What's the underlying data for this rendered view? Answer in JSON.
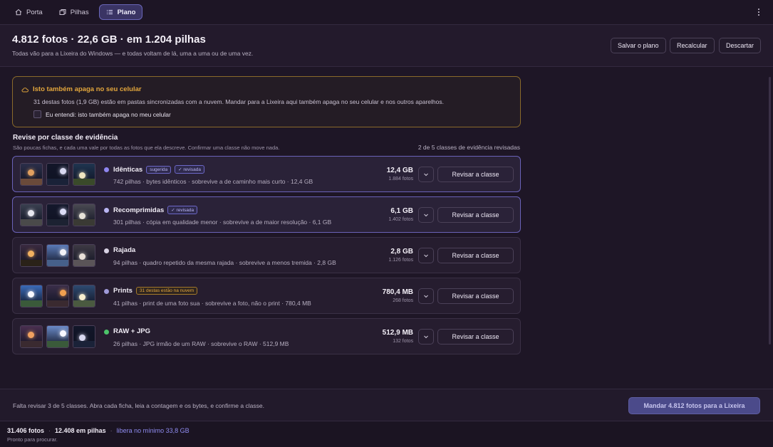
{
  "nav": {
    "tabs": [
      {
        "label": "Porta",
        "icon": "home-icon"
      },
      {
        "label": "Pilhas",
        "icon": "stack-icon"
      },
      {
        "label": "Plano",
        "icon": "list-icon"
      }
    ],
    "active": "Plano"
  },
  "header": {
    "title": "4.812 fotos · 22,6 GB · em 1.204 pilhas",
    "subtitle": "Todas vão para a Lixeira do Windows — e todas voltam de lá, uma a uma ou de uma vez.",
    "buttons": {
      "save": "Salvar o plano",
      "recalc": "Recalcular",
      "discard": "Descartar"
    }
  },
  "warning": {
    "title": "Isto também apaga no seu celular",
    "body": "31 destas fotos (1,9 GB) estão em pastas sincronizadas com a nuvem. Mandar para a Lixeira aqui também apaga no seu celular e nos outros aparelhos.",
    "checkbox_label": "Eu entendi: isto também apaga no meu celular",
    "checked": false
  },
  "review": {
    "title": "Revise por classe de evidência",
    "subtitle": "São poucas fichas, e cada uma vale por todas as fotos que ela descreve. Confirmar uma classe não move nada.",
    "count": "2 de 5 classes de evidência revisadas",
    "button_label": "Revisar a classe",
    "classes": [
      {
        "name": "Idênticas",
        "dot": "#8f86f0",
        "badges": [
          "sugerida",
          "✓ revisada"
        ],
        "badge_style": "purple",
        "desc": "742 pilhas · bytes idênticos · sobrevive a de caminho mais curto · 12,4 GB",
        "size": "12,4 GB",
        "photos": "1.884 fotos",
        "reviewed": true
      },
      {
        "name": "Recomprimidas",
        "dot": "#b9b5f2",
        "badges": [
          "✓ revisada"
        ],
        "badge_style": "purple",
        "desc": "301 pilhas · cópia em qualidade menor · sobrevive a de maior resolução · 6,1 GB",
        "size": "6,1 GB",
        "photos": "1.402 fotos",
        "reviewed": true
      },
      {
        "name": "Rajada",
        "dot": "#d8d2e4",
        "badges": [],
        "badge_style": "none",
        "desc": "94 pilhas · quadro repetido da mesma rajada · sobrevive a menos tremida · 2,8 GB",
        "size": "2,8 GB",
        "photos": "1.126 fotos",
        "reviewed": false
      },
      {
        "name": "Prints",
        "dot": "#9f9ad8",
        "badges": [
          "31 destas estão na nuvem"
        ],
        "badge_style": "amber",
        "desc": "41 pilhas · print de uma foto sua · sobrevive a foto, não o print · 780,4 MB",
        "size": "780,4 MB",
        "photos": "268 fotos",
        "reviewed": false
      },
      {
        "name": "RAW + JPG",
        "dot": "#4cc46a",
        "badges": [],
        "badge_style": "none",
        "desc": "26 pilhas · JPG irmão de um RAW · sobrevive o RAW · 512,9 MB",
        "size": "512,9 MB",
        "photos": "132 fotos",
        "reviewed": false
      }
    ]
  },
  "action": {
    "text": "Falta revisar 3 de 5 classes. Abra cada ficha, leia a contagem e os bytes, e confirme a classe.",
    "primary": "Mandar 4.812 fotos para a Lixeira"
  },
  "status": {
    "photos": "31.406 fotos",
    "stacks": "12.408 em pilhas",
    "frees": "libera no mínimo 33,8 GB",
    "message": "Pronto para procurar."
  }
}
